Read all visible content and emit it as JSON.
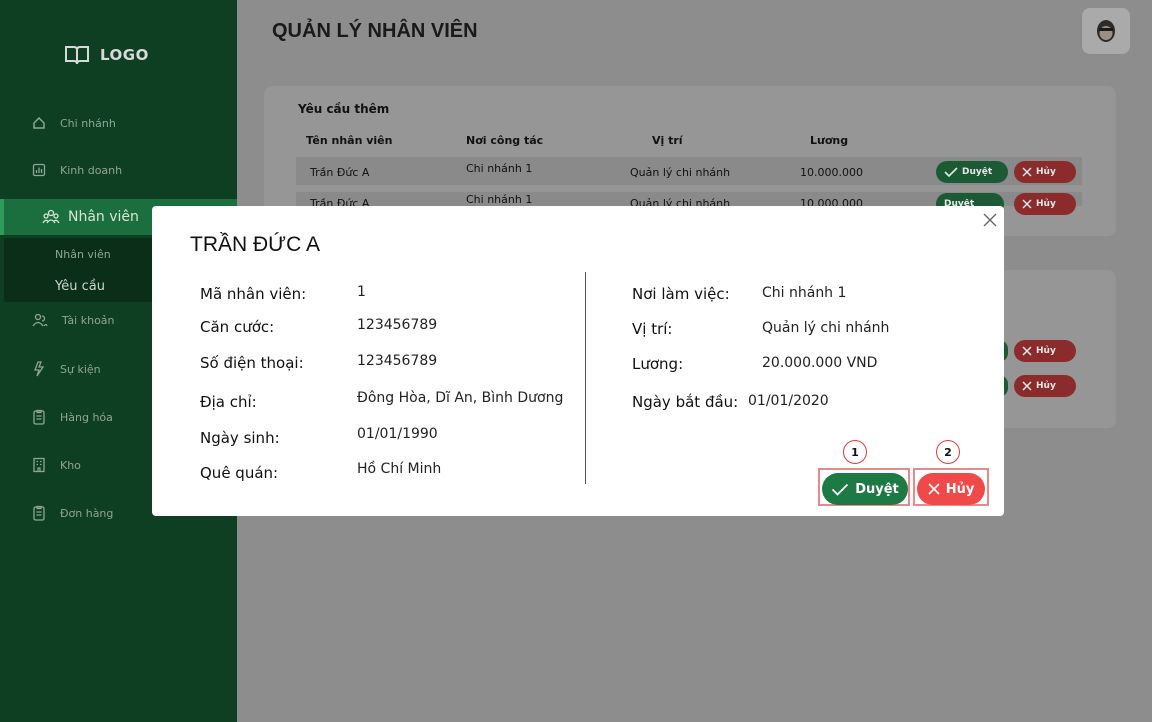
{
  "sidebar": {
    "logo": "LOGO",
    "items": [
      {
        "label": "Chi nhánh",
        "icon": "home-icon"
      },
      {
        "label": "Kinh doanh",
        "icon": "chart-icon"
      },
      {
        "label": "Nhân viên",
        "icon": "users-icon"
      },
      {
        "label": "Tài khoản",
        "icon": "account-icon"
      },
      {
        "label": "Sự kiện",
        "icon": "event-icon"
      },
      {
        "label": "Hàng hóa",
        "icon": "clipboard-icon"
      },
      {
        "label": "Kho",
        "icon": "building-icon"
      },
      {
        "label": "Đơn hàng",
        "icon": "order-icon"
      }
    ],
    "sub_items": [
      "Nhân viên",
      "Yêu cầu"
    ]
  },
  "header": {
    "title": "QUẢN LÝ NHÂN VIÊN"
  },
  "requests": {
    "title": "Yêu cầu thêm",
    "columns": [
      "Tên nhân viên",
      "Nơi công tác",
      "Vị trí",
      "Lương"
    ],
    "rows": [
      {
        "name": "Trần Đức A",
        "branch": "Chi nhánh 1",
        "position": "Quản lý chi nhánh",
        "salary": "10.000.000"
      },
      {
        "name": "Trần Đức A",
        "branch": "Chi nhánh 1",
        "position": "Quản lý chi nhánh",
        "salary": "10.000.000"
      }
    ],
    "approve_label": "Duyệt",
    "cancel_label": "Hủy"
  },
  "modal": {
    "title": "TRẦN ĐỨC A",
    "left_fields": [
      {
        "label": "Mã nhân viên:",
        "value": "1"
      },
      {
        "label": "Căn cước:",
        "value": "123456789"
      },
      {
        "label": "Số điện thoại:",
        "value": "123456789"
      },
      {
        "label": "Địa chỉ:",
        "value": "Đông Hòa, Dĩ An, Bình Dương"
      },
      {
        "label": "Ngày sinh:",
        "value": "01/01/1990"
      },
      {
        "label": "Quê quán:",
        "value": "Hồ Chí Minh"
      }
    ],
    "right_fields": [
      {
        "label": "Nơi làm việc:",
        "value": "Chi nhánh 1"
      },
      {
        "label": "Vị trí:",
        "value": "Quản lý chi nhánh"
      },
      {
        "label": "Lương:",
        "value": "20.000.000 VND"
      },
      {
        "label": "Ngày bắt đầu:",
        "value": "01/01/2020"
      }
    ],
    "approve_label": "Duyệt",
    "cancel_label": "Hủy",
    "badges": [
      "1",
      "2"
    ]
  },
  "colors": {
    "sidebar": "#0f3f22",
    "active_item": "#1b6e3d",
    "approve": "#1e7a45",
    "cancel": "#ef4949",
    "highlight": "#e88a8a"
  }
}
